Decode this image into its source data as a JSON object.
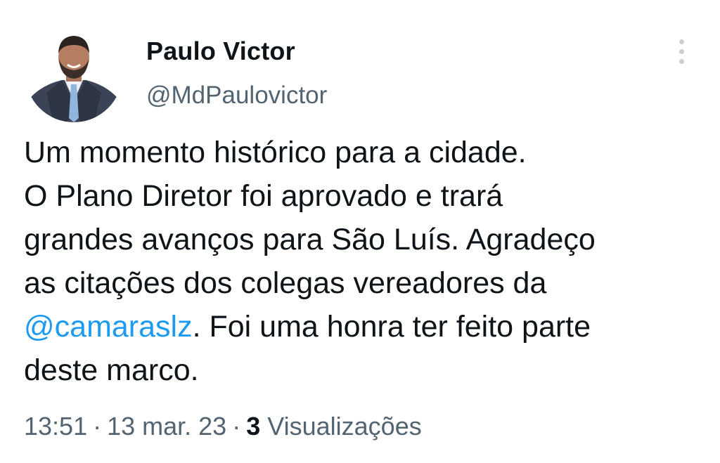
{
  "tweet": {
    "author": {
      "display_name": "Paulo Victor",
      "handle": "@MdPaulovictor",
      "avatar_icon": "profile-photo"
    },
    "text": {
      "line1": "Um momento histórico para a cidade.",
      "line2": "O Plano Diretor foi aprovado e trará",
      "line3": "grandes avanços para São Luís. Agradeço",
      "line4": "as citações dos colegas vereadores da",
      "mention": "@camaraslz",
      "line5_rest": ". Foi uma honra ter feito parte",
      "line6": "deste marco."
    },
    "meta": {
      "time": "13:51",
      "separator": "·",
      "date": "13 mar. 23",
      "views_count": "3",
      "views_label": "Visualizações"
    },
    "menu_icon": "more-vertical-icon"
  },
  "colors": {
    "text": "#0f1419",
    "secondary_text": "#536471",
    "link": "#1d9bf0",
    "menu_dots": "#c9ced3"
  }
}
